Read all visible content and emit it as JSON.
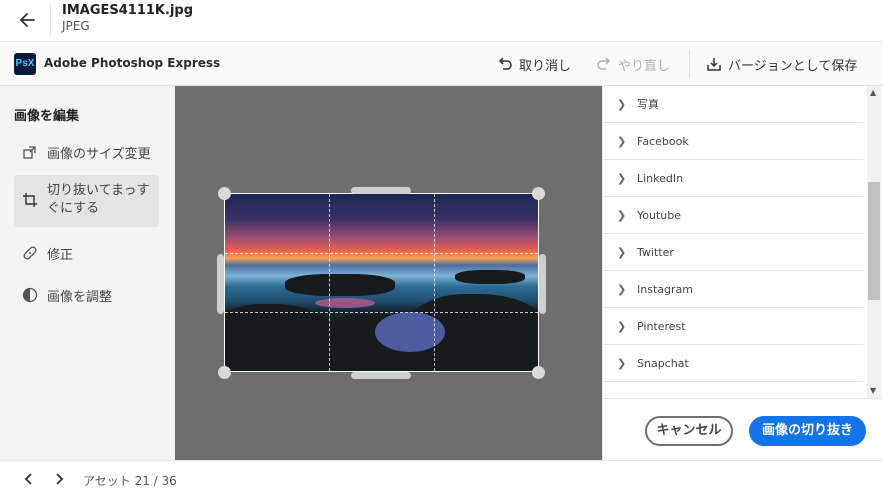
{
  "header": {
    "file_name": "IMAGES4111K.jpg",
    "file_type": "JPEG"
  },
  "appbar": {
    "app_name": "Adobe Photoshop Express",
    "logo_text": "PsX",
    "undo_label": "取り消し",
    "redo_label": "やり直し",
    "save_label": "バージョンとして保存"
  },
  "left_panel": {
    "title": "画像を編集",
    "items": [
      {
        "label": "画像のサイズ変更",
        "icon": "resize-icon"
      },
      {
        "label": "切り抜いてまっすぐにする",
        "icon": "crop-icon",
        "active": true
      },
      {
        "label": "修正",
        "icon": "healing-icon"
      },
      {
        "label": "画像を調整",
        "icon": "adjust-icon"
      }
    ]
  },
  "right_panel": {
    "items": [
      "写真",
      "Facebook",
      "LinkedIn",
      "Youtube",
      "Twitter",
      "Instagram",
      "Pinterest",
      "Snapchat"
    ],
    "cancel_label": "キャンセル",
    "crop_label": "画像の切り抜き"
  },
  "footer": {
    "assets_label": "アセット 21 / 36"
  },
  "colors": {
    "accent": "#1473e6",
    "canvas": "#6e6e6e",
    "panel": "#f4f4f4"
  }
}
